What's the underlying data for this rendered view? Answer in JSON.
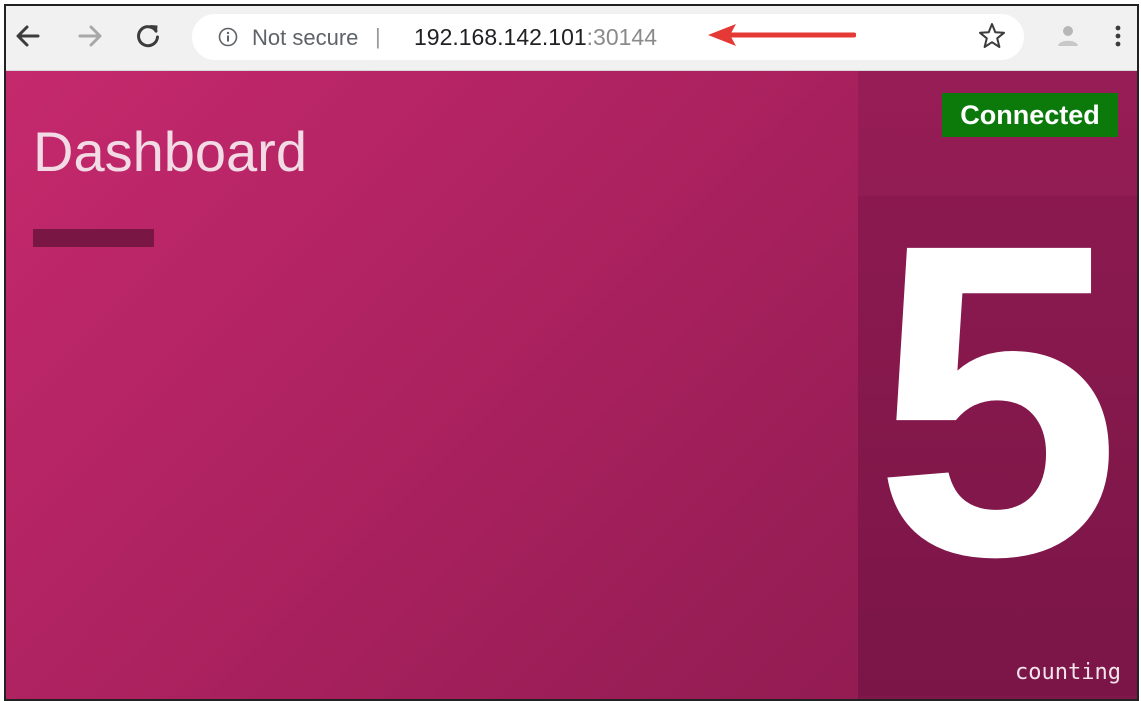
{
  "browser": {
    "back_icon": "arrow-left-icon",
    "forward_icon": "arrow-right-icon",
    "reload_icon": "reload-icon",
    "security_icon": "info-icon",
    "security_label": "Not secure",
    "separator": "|",
    "url_host": "192.168.142.101",
    "url_port": ":30144",
    "bookmark_icon": "star-icon",
    "profile_icon": "profile-icon",
    "menu_icon": "kebab-menu-icon",
    "annotation_arrow_color": "#e53935"
  },
  "page": {
    "title": "Dashboard",
    "status": "Connected",
    "status_color": "#0b7a0b",
    "counter_value": "5",
    "counter_caption": "counting",
    "accent_color": "#b0245f"
  }
}
